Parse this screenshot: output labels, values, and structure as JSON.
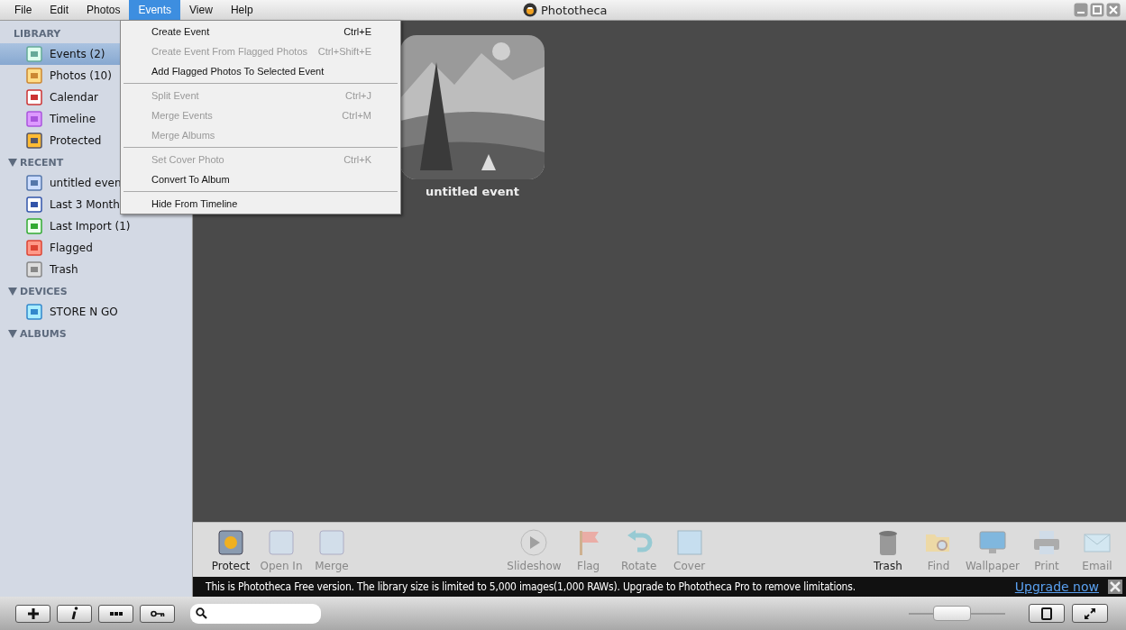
{
  "window": {
    "title": "Phototheca"
  },
  "menu_bar": [
    {
      "label": "File",
      "selected": false
    },
    {
      "label": "Edit",
      "selected": false
    },
    {
      "label": "Photos",
      "selected": false
    },
    {
      "label": "Events",
      "selected": true
    },
    {
      "label": "View",
      "selected": false
    },
    {
      "label": "Help",
      "selected": false
    }
  ],
  "events_menu": [
    [
      {
        "label": "Create Event",
        "shortcut": "Ctrl+E",
        "disabled": false
      },
      {
        "label": "Create Event From Flagged Photos",
        "shortcut": "Ctrl+Shift+E",
        "disabled": true
      },
      {
        "label": "Add Flagged Photos To Selected Event",
        "disabled": false
      }
    ],
    [
      {
        "label": "Split Event",
        "shortcut": "Ctrl+J",
        "disabled": true
      },
      {
        "label": "Merge Events",
        "shortcut": "Ctrl+M",
        "disabled": true
      },
      {
        "label": "Merge Albums",
        "disabled": true
      }
    ],
    [
      {
        "label": "Set Cover Photo",
        "shortcut": "Ctrl+K",
        "disabled": true
      },
      {
        "label": "Convert To Album",
        "disabled": false
      }
    ],
    [
      {
        "label": "Hide From Timeline",
        "disabled": false
      }
    ]
  ],
  "sidebar": [
    {
      "title": "LIBRARY",
      "items": [
        {
          "label": "Events (2)",
          "selected": true
        },
        {
          "label": "Photos (10)",
          "selected": false
        },
        {
          "label": "Calendar",
          "selected": false
        },
        {
          "label": "Timeline",
          "selected": false
        },
        {
          "label": "Protected",
          "selected": false
        }
      ]
    },
    {
      "title": "RECENT",
      "expanded": true,
      "items": [
        {
          "label": "untitled even",
          "selected": false
        },
        {
          "label": "Last 3 Month",
          "selected": false
        },
        {
          "label": "Last Import (1)",
          "selected": false
        },
        {
          "label": "Flagged",
          "selected": false
        },
        {
          "label": "Trash",
          "selected": false
        }
      ]
    },
    {
      "title": "DEVICES",
      "expanded": true,
      "items": [
        {
          "label": "STORE N GO",
          "selected": false
        }
      ]
    },
    {
      "title": "ALBUMS",
      "expanded": true
    }
  ],
  "events": [
    {
      "title": "untitled event"
    }
  ],
  "toolbar_left": [
    {
      "label": "Protect",
      "disabled": false
    },
    {
      "label": "Open In",
      "disabled": true
    },
    {
      "label": "Merge",
      "disabled": true
    }
  ],
  "toolbar_center": [
    {
      "label": "Slideshow",
      "disabled": true
    },
    {
      "label": "Flag",
      "disabled": true
    },
    {
      "label": "Rotate",
      "disabled": true
    },
    {
      "label": "Cover",
      "disabled": true
    }
  ],
  "toolbar_right": [
    {
      "label": "Trash",
      "disabled": false
    },
    {
      "label": "Find",
      "disabled": true
    },
    {
      "label": "Wallpaper",
      "disabled": true
    },
    {
      "label": "Print",
      "disabled": true
    },
    {
      "label": "Email",
      "disabled": true
    }
  ],
  "banner": {
    "message": "This is Phototheca Free version. The library size is limited to 5,000 images(1,000 RAWs). Upgrade to Phototheca Pro to remove limitations.",
    "link": "Upgrade now"
  },
  "zoom_slider": {
    "level": 0.45
  }
}
